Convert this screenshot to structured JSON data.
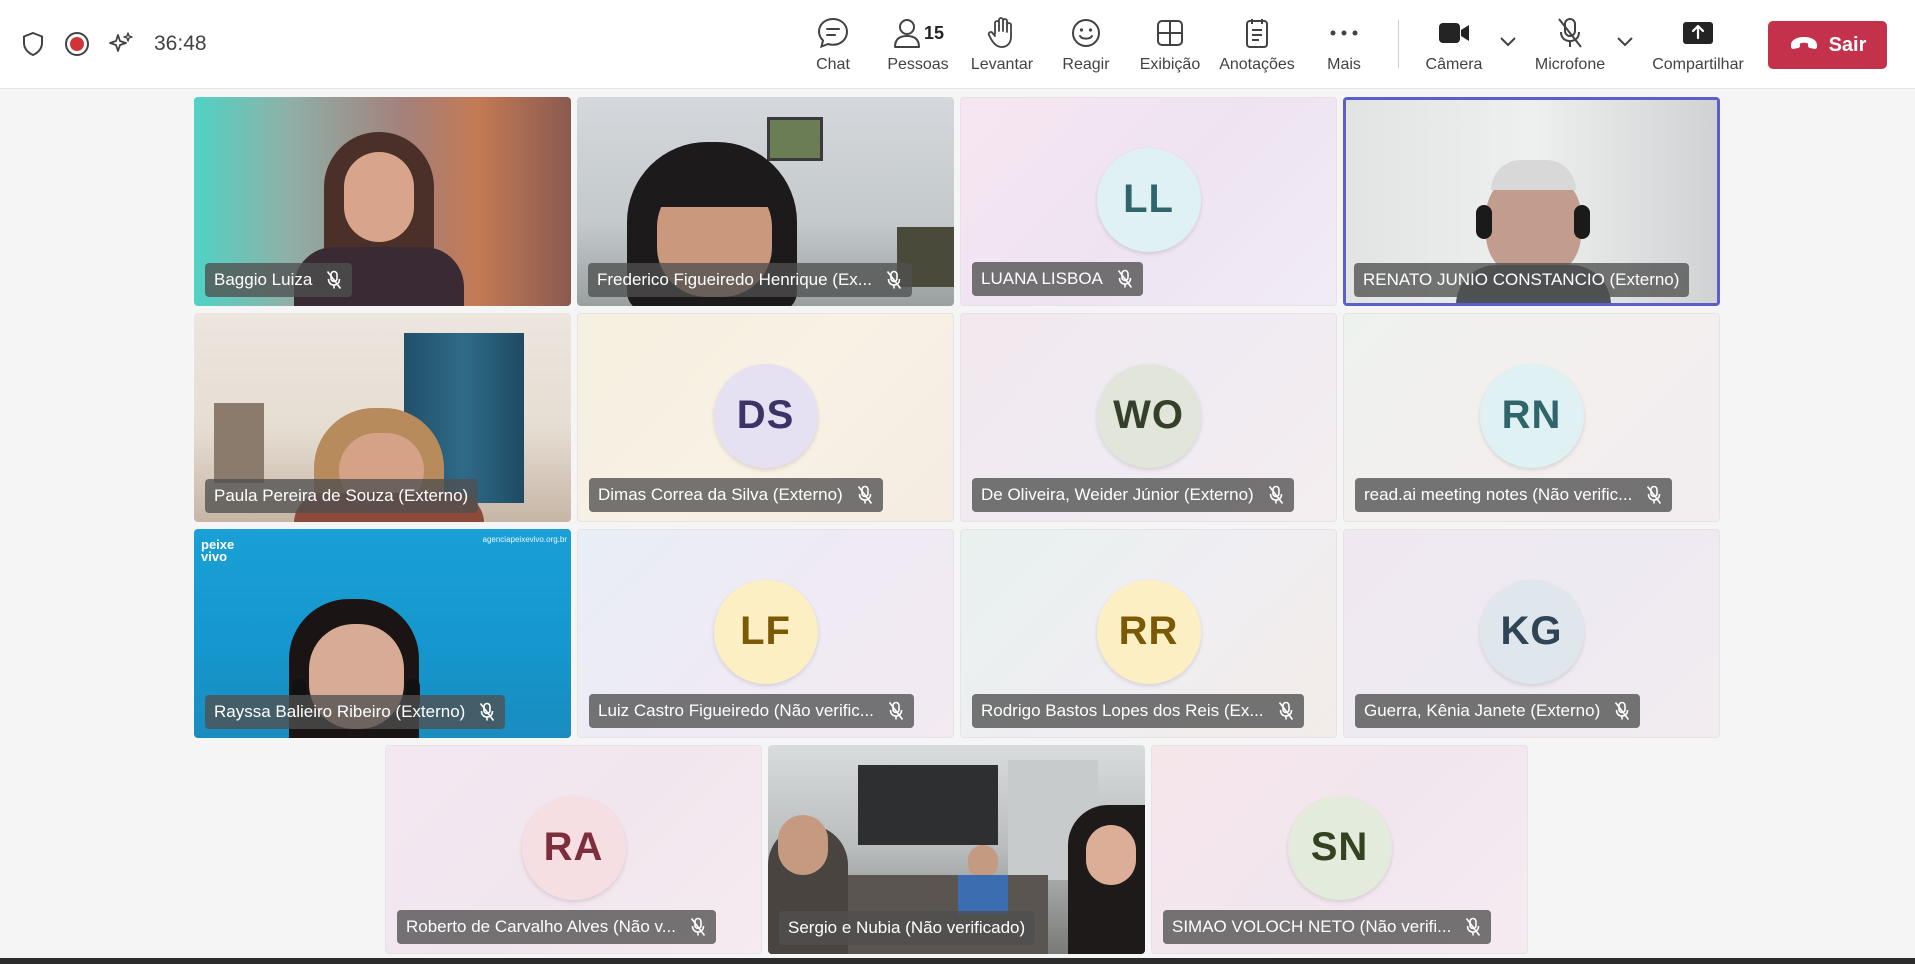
{
  "toolbar": {
    "timer": "36:48",
    "chat_label": "Chat",
    "people_label": "Pessoas",
    "people_count": "15",
    "raise_label": "Levantar",
    "react_label": "Reagir",
    "view_label": "Exibição",
    "notes_label": "Anotações",
    "more_label": "Mais",
    "camera_label": "Câmera",
    "mic_label": "Microfone",
    "share_label": "Compartilhar",
    "leave_label": "Sair",
    "leave_color": "#c4314b"
  },
  "participants": [
    {
      "name": "Baggio Luiza",
      "type": "video",
      "muted": true
    },
    {
      "name": "Frederico Figueiredo Henrique (Ex...",
      "type": "video",
      "muted": true
    },
    {
      "name": "LUANA LISBOA",
      "type": "avatar",
      "initials": "LL",
      "muted": true
    },
    {
      "name": "RENATO JUNIO CONSTANCIO (Externo)",
      "type": "video",
      "muted": false,
      "active_speaker": true
    },
    {
      "name": "Paula Pereira de Souza (Externo)",
      "type": "video",
      "muted": false
    },
    {
      "name": "Dimas Correa da Silva (Externo)",
      "type": "avatar",
      "initials": "DS",
      "muted": true
    },
    {
      "name": "De Oliveira, Weider Júnior (Externo)",
      "type": "avatar",
      "initials": "WO",
      "muted": true
    },
    {
      "name": "read.ai meeting notes (Não verific...",
      "type": "avatar",
      "initials": "RN",
      "muted": true
    },
    {
      "name": "Rayssa Balieiro Ribeiro (Externo)",
      "type": "video",
      "muted": true
    },
    {
      "name": "Luiz Castro Figueiredo (Não verific...",
      "type": "avatar",
      "initials": "LF",
      "muted": true
    },
    {
      "name": "Rodrigo Bastos Lopes dos Reis (Ex...",
      "type": "avatar",
      "initials": "RR",
      "muted": true
    },
    {
      "name": "Guerra, Kênia Janete (Externo)",
      "type": "avatar",
      "initials": "KG",
      "muted": true
    },
    {
      "name": "Roberto de Carvalho Alves (Não v...",
      "type": "avatar",
      "initials": "RA",
      "muted": true
    },
    {
      "name": "Sergio e Nubia (Não verificado)",
      "type": "video",
      "muted": false
    },
    {
      "name": "SIMAO VOLOCH NETO (Não verifi...",
      "type": "avatar",
      "initials": "SN",
      "muted": true
    }
  ],
  "video_overlay_text": {
    "brand": "peixe vivo",
    "url": "agenciapeixevivo.org.br"
  },
  "colors": {
    "accent": "#5b5fc7",
    "avatar_LL": "#dff1f3",
    "avatar_DS": "#e5e0f2",
    "avatar_WO": "#e2e6da",
    "avatar_RN": "#dff1f3",
    "avatar_LF": "#fcefc4",
    "avatar_RR": "#fcefc4",
    "avatar_KG": "#dfe6ec",
    "avatar_RA": "#f6dfe3",
    "avatar_SN": "#e3ebdd"
  }
}
